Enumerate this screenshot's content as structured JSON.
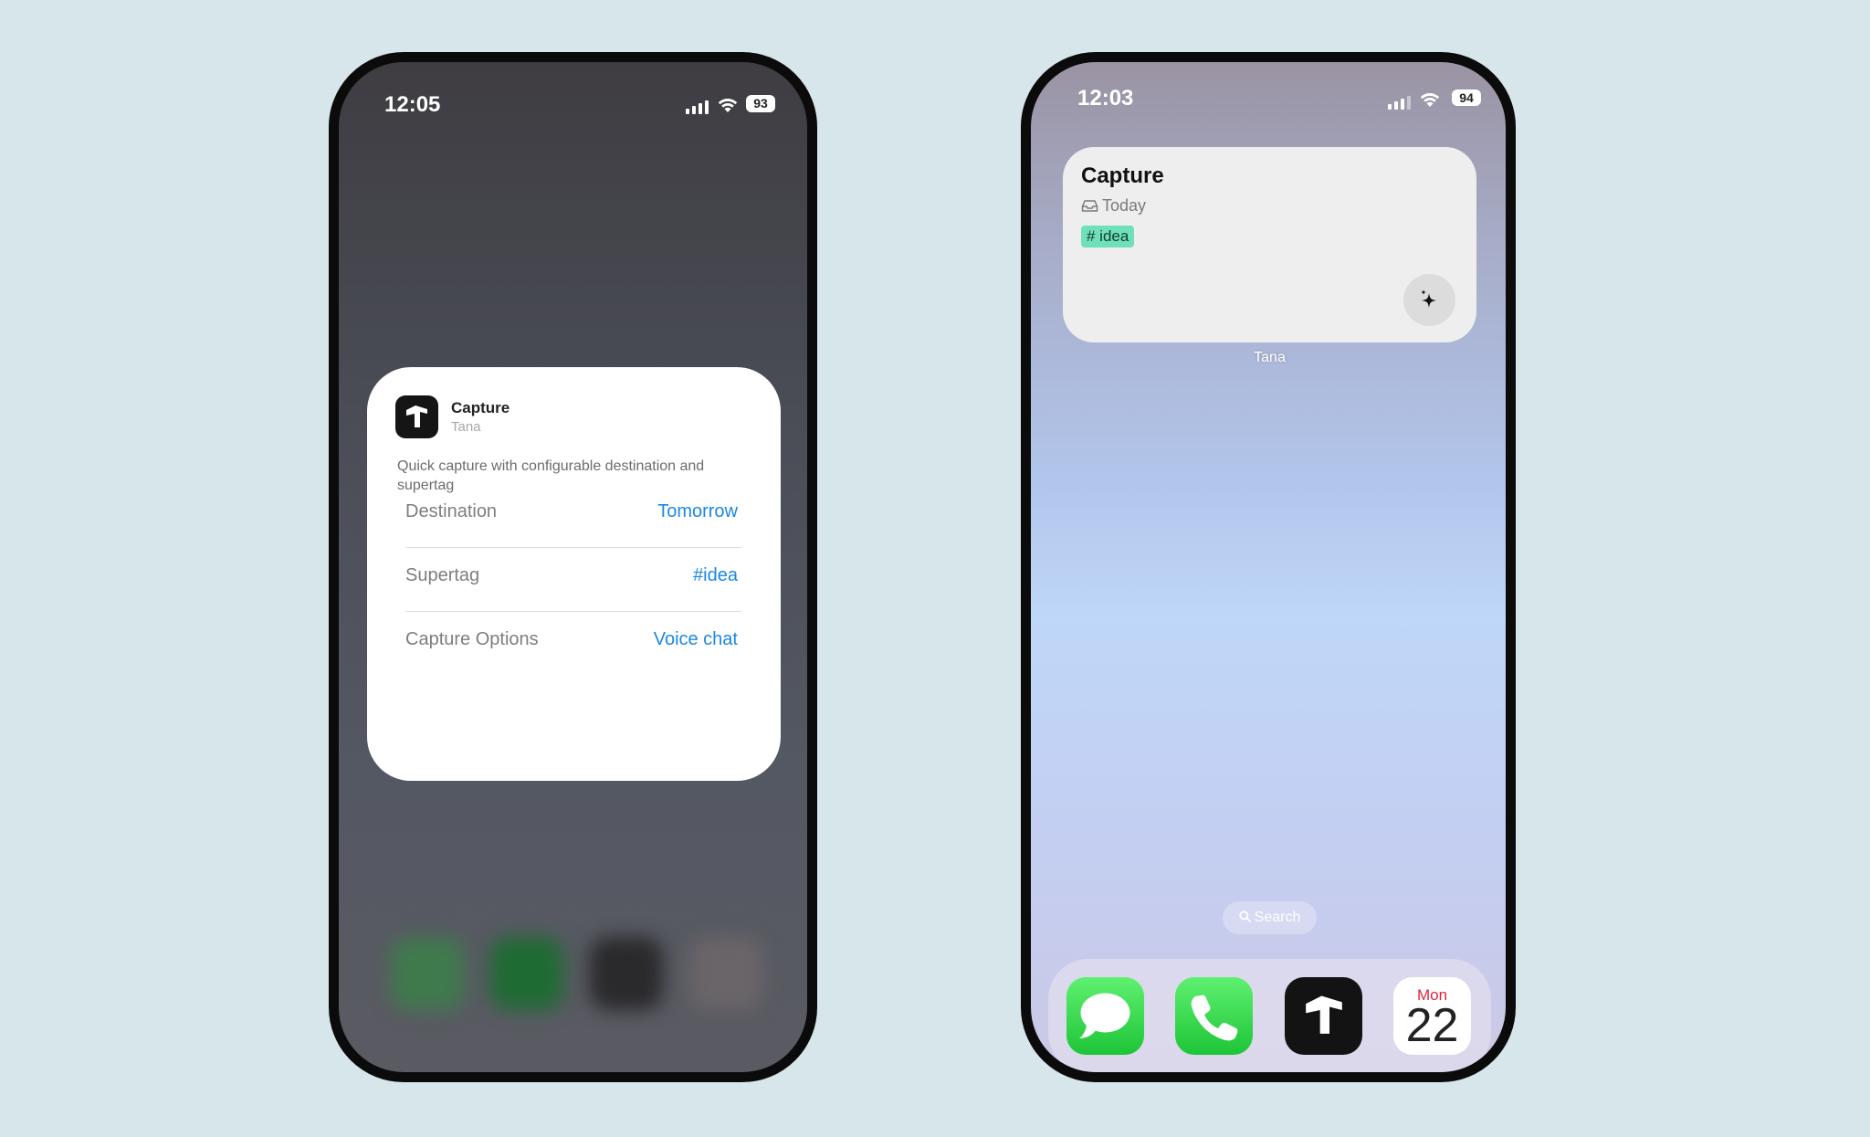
{
  "colors": {
    "background": "#d7e6ea",
    "link": "#1b88e3",
    "tag": "#6fe0b9",
    "calendar_red": "#e5243b"
  },
  "left_phone": {
    "status": {
      "time": "12:05",
      "battery": "93"
    },
    "config": {
      "app_icon": "tana-logo-icon",
      "title": "Capture",
      "subtitle": "Tana",
      "description": "Quick capture with configurable destination and supertag",
      "rows": [
        {
          "label": "Destination",
          "value": "Tomorrow"
        },
        {
          "label": "Supertag",
          "value": "#idea"
        },
        {
          "label": "Capture Options",
          "value": "Voice chat"
        }
      ]
    }
  },
  "right_phone": {
    "status": {
      "time": "12:03",
      "battery": "94"
    },
    "widget": {
      "title": "Capture",
      "destination_icon": "inbox-icon",
      "destination": "Today",
      "tag": "# idea",
      "action_icon": "sparkle-icon",
      "label": "Tana"
    },
    "search": "Search",
    "dock": [
      {
        "name": "Messages",
        "icon": "messages-icon"
      },
      {
        "name": "Phone",
        "icon": "phone-icon"
      },
      {
        "name": "Tana",
        "icon": "tana-logo-icon"
      },
      {
        "name": "Calendar",
        "month": "Mon",
        "day": "22"
      }
    ]
  }
}
